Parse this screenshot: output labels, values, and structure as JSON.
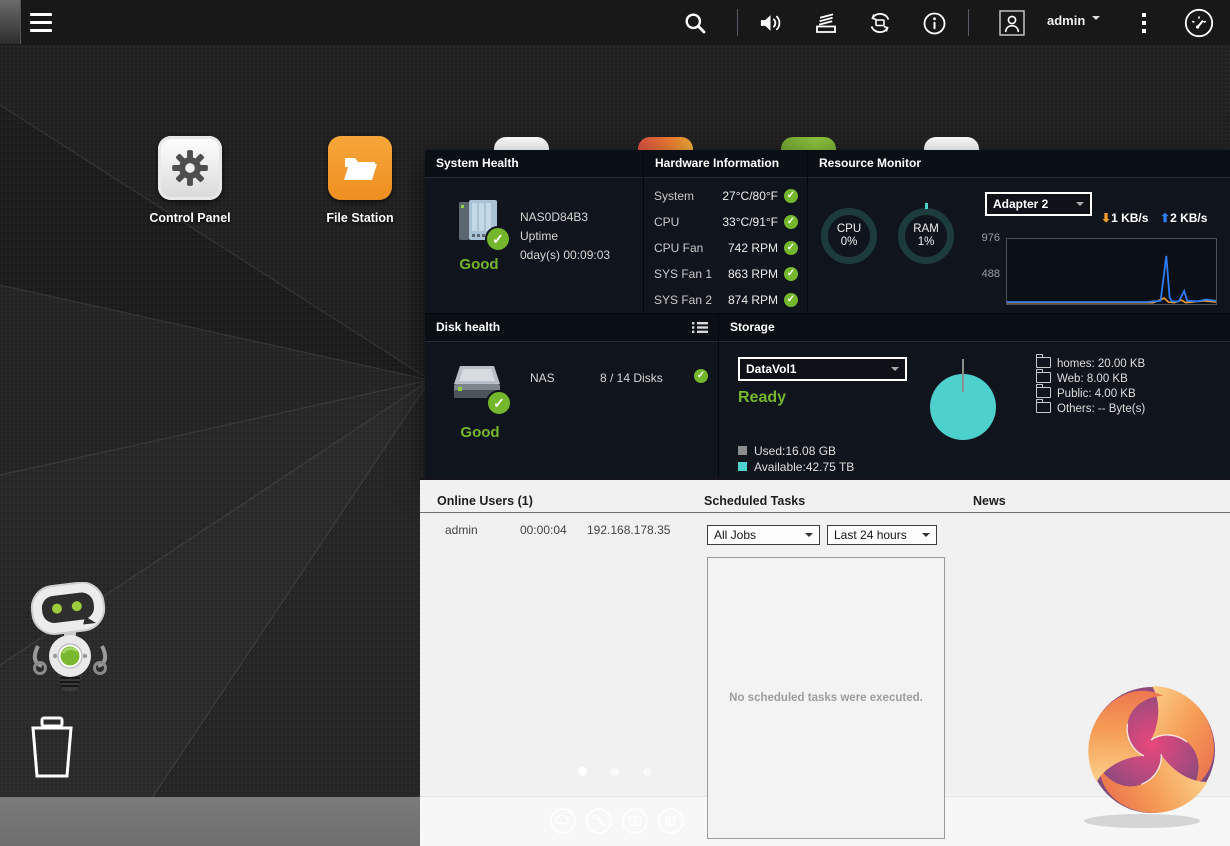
{
  "colors": {
    "green": "#74b72c",
    "cyan": "#4ed0cc",
    "blue": "#2e7cf6",
    "orange": "#f09d2e"
  },
  "topbar": {
    "user": "admin"
  },
  "desktop": {
    "control_panel": "Control Panel",
    "file_station": "File Station"
  },
  "dashboard": {
    "system_health": {
      "title": "System Health",
      "device": "NAS0D84B3",
      "uptime_label": "Uptime",
      "uptime_value": "0day(s) 00:09:03",
      "status": "Good"
    },
    "hardware": {
      "title": "Hardware Information",
      "rows": [
        {
          "label": "System",
          "value": "27°C/80°F"
        },
        {
          "label": "CPU",
          "value": "33°C/91°F"
        },
        {
          "label": "CPU Fan",
          "value": "742 RPM"
        },
        {
          "label": "SYS Fan 1",
          "value": "863 RPM"
        },
        {
          "label": "SYS Fan 2",
          "value": "874 RPM"
        }
      ]
    },
    "resource": {
      "title": "Resource Monitor",
      "cpu_label": "CPU",
      "cpu_value": "0%",
      "ram_label": "RAM",
      "ram_value": "1%",
      "adapter": "Adapter 2",
      "down_rate": "1 KB/s",
      "up_rate": "2 KB/s",
      "tick_top": "976",
      "tick_bottom": "488",
      "graph": {
        "up": [
          [
            0,
            0.03
          ],
          [
            0.67,
            0.03
          ],
          [
            0.735,
            0.05
          ],
          [
            0.762,
            0.74
          ],
          [
            0.778,
            0.1
          ],
          [
            0.79,
            0.04
          ],
          [
            0.822,
            0.04
          ],
          [
            0.848,
            0.2
          ],
          [
            0.862,
            0.05
          ],
          [
            0.91,
            0.04
          ],
          [
            0.953,
            0.07
          ],
          [
            1,
            0.05
          ]
        ],
        "down": [
          [
            0,
            0.02
          ],
          [
            0.7,
            0.02
          ],
          [
            0.752,
            0.09
          ],
          [
            0.772,
            0.03
          ],
          [
            0.8,
            0.02
          ],
          [
            0.835,
            0.06
          ],
          [
            0.855,
            0.02
          ],
          [
            0.94,
            0.05
          ],
          [
            1,
            0.03
          ]
        ]
      }
    },
    "disk": {
      "title": "Disk health",
      "host": "NAS",
      "disks": "8 / 14 Disks",
      "status": "Good"
    },
    "storage": {
      "title": "Storage",
      "volume": "DataVol1",
      "status": "Ready",
      "used": "Used:16.08 GB",
      "available": "Available:42.75 TB",
      "folders": [
        "homes: 20.00 KB",
        "Web: 8.00 KB",
        "Public: 4.00 KB",
        "Others: -- Byte(s)"
      ]
    }
  },
  "widgets": {
    "online_users": {
      "title": "Online Users (1)",
      "user": "admin",
      "duration": "00:00:04",
      "ip": "192.168.178.35"
    },
    "scheduled": {
      "title": "Scheduled Tasks",
      "jobs_filter": "All Jobs",
      "time_filter": "Last 24 hours",
      "empty_message": "No scheduled tasks were executed."
    },
    "news": {
      "title": "News"
    }
  }
}
